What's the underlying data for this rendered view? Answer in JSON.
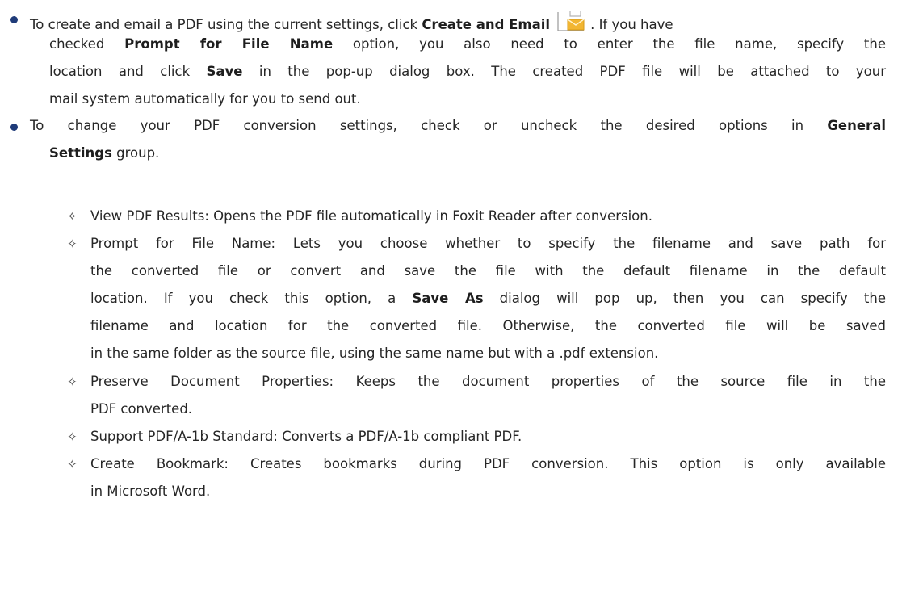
{
  "bullet1": {
    "line1_pre": "To create and email a PDF using the current settings, click ",
    "line1_bold": "Create and Email",
    "line1_post": ". If you have",
    "line2_pre": "checked ",
    "line2_bold": "Prompt for File Name",
    "line2_post": " option, you also need to enter the file name, specify the",
    "line3_pre": "location and click ",
    "line3_bold": "Save",
    "line3_post": " in the pop-up dialog box. The created PDF file will be attached to your",
    "line4": "mail system automatically for you to send out.",
    "icon": "email-envelope-icon"
  },
  "bullet2": {
    "line1_pre": "To change your PDF conversion settings, check or uncheck the desired options in ",
    "line1_bold": "General",
    "line2_bold": "Settings",
    "line2_post": " group."
  },
  "sub_marker": "✧",
  "sub_items": {
    "view": "View PDF Results: Opens the PDF file automatically in Foxit Reader after conversion.",
    "prompt_l1": "Prompt for File Name: Lets you choose whether to specify the filename and save path for",
    "prompt_l2": "the converted file or convert and save the file with the default filename in the default",
    "prompt_l3_pre": "location. If you check this option, a ",
    "prompt_l3_bold": "Save As",
    "prompt_l3_post": " dialog will pop up, then you can specify the",
    "prompt_l4": "filename and location for the converted file. Otherwise, the converted file will be saved",
    "prompt_l5": "in the same folder as the source file, using the same name but with a .pdf extension.",
    "preserve_l1": "Preserve Document Properties: Keeps the document properties of the source file in the",
    "preserve_l2": "PDF converted.",
    "pdfa": "Support PDF/A-1b Standard: Converts a PDF/A-1b compliant PDF.",
    "bookmark_l1": "Create Bookmark: Creates bookmarks during PDF conversion. This option is only available",
    "bookmark_l2": "in Microsoft Word."
  },
  "colors": {
    "bullet": "#1f3b79",
    "envelope": "#f2b632",
    "text": "#262626"
  }
}
